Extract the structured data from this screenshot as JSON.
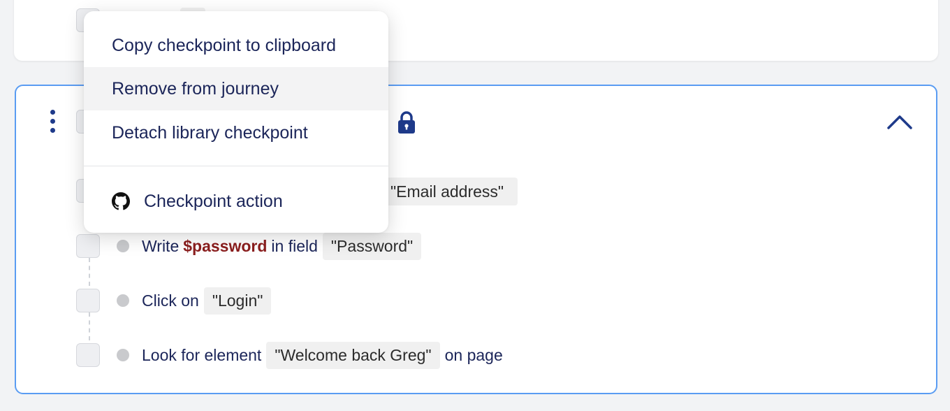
{
  "menu": {
    "items": [
      {
        "label": "Copy checkpoint to clipboard"
      },
      {
        "label": "Remove from journey"
      },
      {
        "label": "Detach library checkpoint"
      }
    ],
    "action": {
      "label": "Checkpoint action",
      "icon": "github-icon"
    }
  },
  "steps": {
    "email_chip_partial": "\"Email address\"",
    "password": {
      "prefix": "Write",
      "variable": "$password",
      "middle": "in field",
      "target": "\"Password\""
    },
    "login": {
      "prefix": "Click on",
      "target": "\"Login\""
    },
    "welcome": {
      "prefix": "Look for element",
      "target": "\"Welcome back Greg\"",
      "suffix": "on page"
    }
  },
  "colors": {
    "accent_border": "#5a9cf2",
    "icon_dark_blue": "#1e3a8a",
    "variable": "#8b1e1e",
    "text": "#1b2559"
  },
  "icons": {
    "kebab": "more-vertical-icon",
    "lock": "lock-icon",
    "collapse": "chevron-up-icon"
  }
}
